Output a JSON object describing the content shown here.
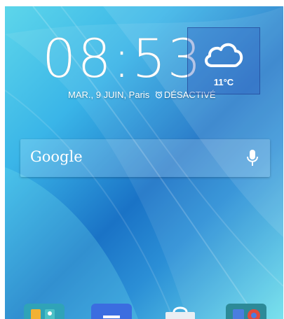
{
  "clock": {
    "time": "08:53"
  },
  "date": {
    "text": "MAR., 9 JUIN, Paris",
    "alarm_text": "DÉSACTIVÉ"
  },
  "weather": {
    "temperature": "11°C",
    "icon": "cloud-icon"
  },
  "search": {
    "logo_text": "Google",
    "mic_icon": "mic-icon"
  },
  "dock": {
    "items": [
      "folder-1",
      "app",
      "play-store",
      "folder-2"
    ]
  }
}
